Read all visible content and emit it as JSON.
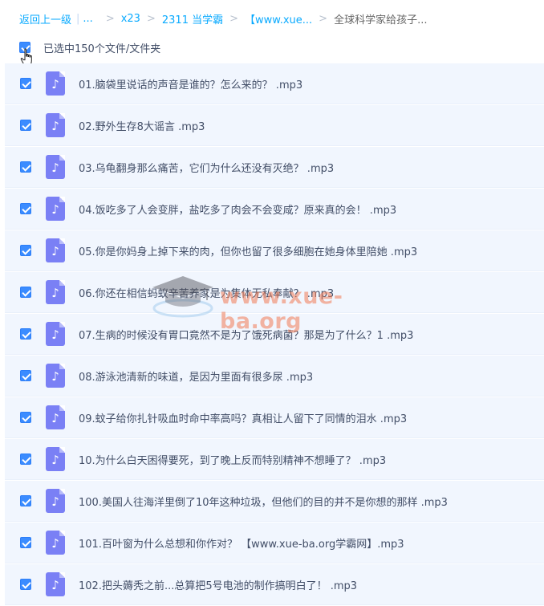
{
  "breadcrumb": {
    "back": "返回上一级",
    "ellipsis": "...",
    "crumbs": [
      "x23",
      "2311 当学霸",
      "【www.xue...",
      "全球科学家给孩子..."
    ]
  },
  "selection": {
    "label": "已选中150个文件/文件夹",
    "checked": true
  },
  "files": [
    {
      "name": "01.脑袋里说话的声音是谁的？怎么来的？ .mp3",
      "checked": true,
      "icon": "music-file-icon"
    },
    {
      "name": "02.野外生存8大谣言 .mp3",
      "checked": true,
      "icon": "music-file-icon"
    },
    {
      "name": "03.乌龟翻身那么痛苦，它们为什么还没有灭绝？ .mp3",
      "checked": true,
      "icon": "music-file-icon"
    },
    {
      "name": "04.饭吃多了人会变胖，盐吃多了肉会不会变咸？原来真的会！ .mp3",
      "checked": true,
      "icon": "music-file-icon"
    },
    {
      "name": "05.你是你妈身上掉下来的肉，但你也留了很多细胞在她身体里陪她 .mp3",
      "checked": true,
      "icon": "music-file-icon"
    },
    {
      "name": "06.你还在相信蚂蚁辛苦养家是为集体无私奉献？ .mp3",
      "checked": true,
      "icon": "music-file-icon"
    },
    {
      "name": "07.生病的时候没有胃口竟然不是为了饿死病菌？那是为了什么？1 .mp3",
      "checked": true,
      "icon": "music-file-icon"
    },
    {
      "name": "08.游泳池清新的味道，是因为里面有很多尿 .mp3",
      "checked": true,
      "icon": "music-file-icon"
    },
    {
      "name": "09.蚊子给你扎针吸血时命中率高吗？真相让人留下了同情的泪水 .mp3",
      "checked": true,
      "icon": "music-file-icon"
    },
    {
      "name": "10.为什么白天困得要死，到了晚上反而特别精神不想睡了？ .mp3",
      "checked": true,
      "icon": "music-file-icon"
    },
    {
      "name": "100.美国人往海洋里倒了10年这种垃圾，但他们的目的并不是你想的那样 .mp3",
      "checked": true,
      "icon": "music-file-icon"
    },
    {
      "name": "101.百叶窗为什么总想和你作对？ 【www.xue-ba.org学霸网】.mp3",
      "checked": true,
      "icon": "music-file-icon"
    },
    {
      "name": "102.把头薅秃之前...总算把5号电池的制作搞明白了！ .mp3",
      "checked": true,
      "icon": "music-file-icon"
    }
  ],
  "watermark": {
    "text": "www.xue-ba.org"
  },
  "colors": {
    "link": "#09aaff",
    "checkbox": "#3b8cff",
    "row_bg": "#f1f6fe",
    "file_icon": "#7a80f5",
    "watermark": "#f07a54"
  }
}
